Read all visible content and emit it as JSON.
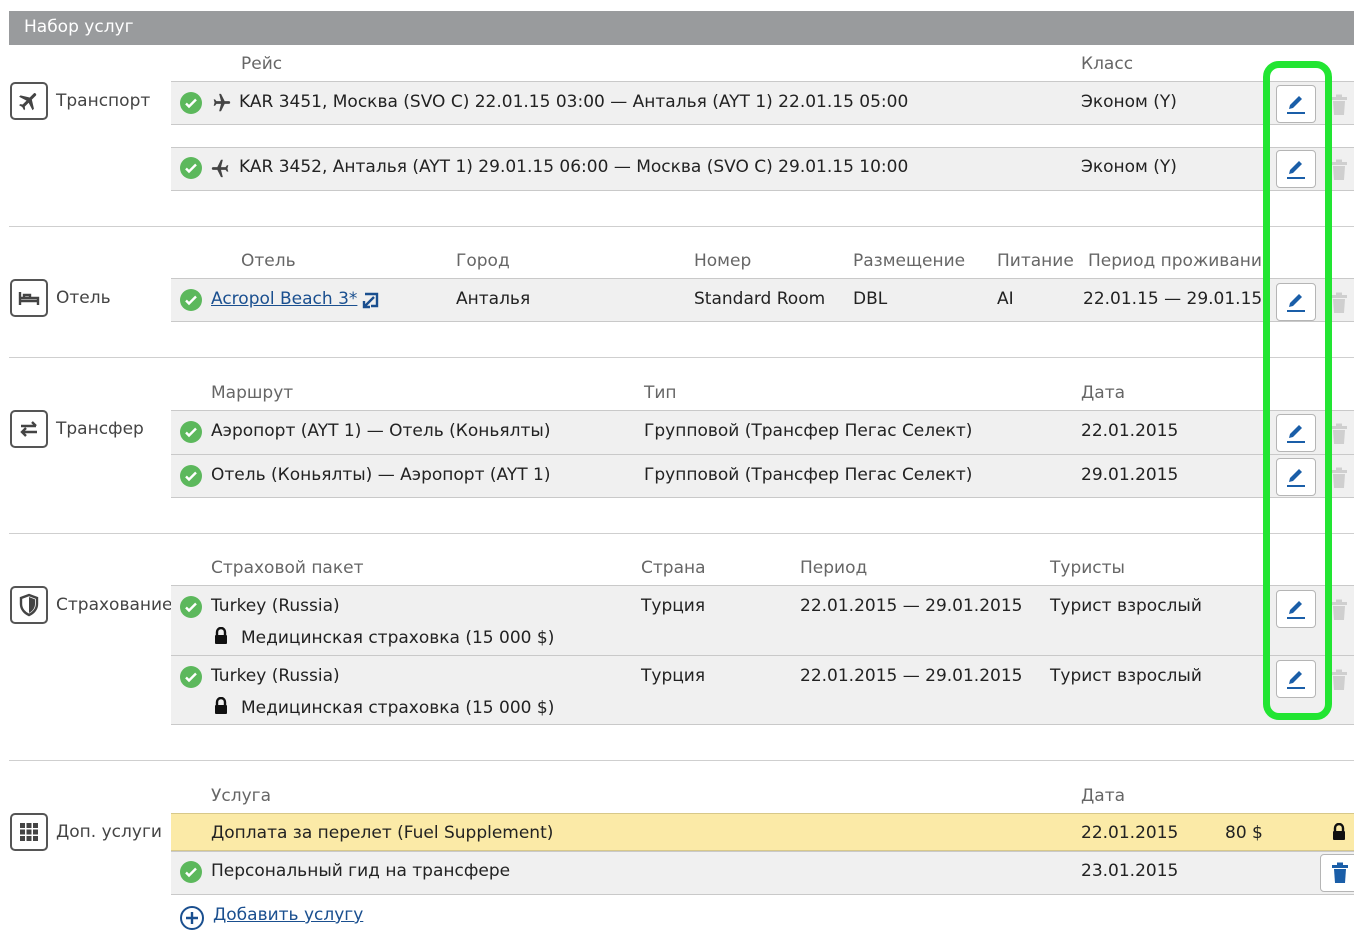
{
  "header": {
    "title": "Набор услуг"
  },
  "transport": {
    "label": "Транспорт",
    "col_flight": "Рейс",
    "col_class": "Класс",
    "rows": [
      {
        "flight": "KAR 3451, Москва (SVO C) 22.01.15 03:00 — Анталья (AYT 1) 22.01.15 05:00",
        "class": "Эконом (Y)"
      },
      {
        "flight": "KAR 3452, Анталья (AYT 1) 29.01.15 06:00 — Москва (SVO C) 29.01.15 10:00",
        "class": "Эконом (Y)"
      }
    ]
  },
  "hotel": {
    "label": "Отель",
    "col_hotel": "Отель",
    "col_city": "Город",
    "col_room": "Номер",
    "col_accommodation": "Размещение",
    "col_meal": "Питание",
    "col_period": "Период проживания",
    "row": {
      "hotel": "Acropol Beach 3*",
      "city": "Анталья",
      "room": "Standard Room",
      "accommodation": "DBL",
      "meal": "AI",
      "period": "22.01.15 — 29.01.15"
    }
  },
  "transfer": {
    "label": "Трансфер",
    "col_route": "Маршрут",
    "col_type": "Тип",
    "col_date": "Дата",
    "rows": [
      {
        "route": "Аэропорт (AYT 1) — Отель (Коньялты)",
        "type": "Групповой (Трансфер Пегас Селект)",
        "date": "22.01.2015"
      },
      {
        "route": "Отель (Коньялты) — Аэропорт (AYT 1)",
        "type": "Групповой (Трансфер Пегас Селект)",
        "date": "29.01.2015"
      }
    ]
  },
  "insurance": {
    "label": "Страхование",
    "col_package": "Страховой пакет",
    "col_country": "Страна",
    "col_period": "Период",
    "col_tourists": "Туристы",
    "rows": [
      {
        "package": "Turkey (Russia)",
        "detail": "Медицинская страховка (15 000 $)",
        "country": "Турция",
        "period": "22.01.2015 — 29.01.2015",
        "tourists": "Турист взрослый"
      },
      {
        "package": "Turkey (Russia)",
        "detail": "Медицинская страховка (15 000 $)",
        "country": "Турция",
        "period": "22.01.2015 — 29.01.2015",
        "tourists": "Турист взрослый"
      }
    ]
  },
  "extra": {
    "label": "Доп. услуги",
    "col_service": "Услуга",
    "col_date": "Дата",
    "rows": [
      {
        "service": "Доплата за перелет (Fuel Supplement)",
        "date": "22.01.2015",
        "price": "80 $"
      },
      {
        "service": "Персональный гид на трансфере",
        "date": "23.01.2015"
      }
    ],
    "add_link": "Добавить услугу"
  },
  "colors": {
    "header_bg": "#999b9d",
    "row_bg": "#f0f0f0",
    "highlight_row": "#fbeaa7",
    "check_green": "#5cb85c",
    "edit_blue": "#1a5ea8",
    "highlight_frame": "#22e532"
  },
  "icons": {
    "transport": "airplane-icon",
    "hotel": "bed-icon",
    "transfer": "arrows-exchange-icon",
    "insurance": "shield-icon",
    "extra": "grid-icon",
    "edit": "pencil-icon",
    "delete": "trash-icon",
    "status": "checkmark-icon",
    "lock": "lock-icon",
    "add": "plus-circle-icon",
    "external": "external-link-icon"
  }
}
